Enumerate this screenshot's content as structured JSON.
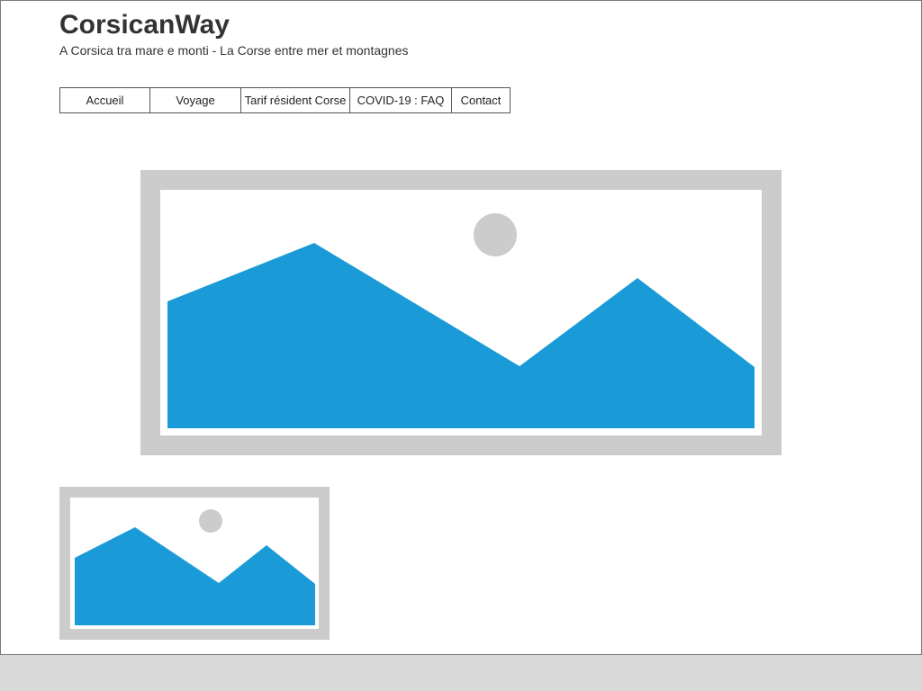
{
  "site": {
    "title": "CorsicanWay",
    "tagline": "A Corsica tra mare e monti - La Corse entre mer et montagnes"
  },
  "nav": {
    "items": [
      {
        "label": "Accueil"
      },
      {
        "label": "Voyage"
      },
      {
        "label": "Tarif résident Corse"
      },
      {
        "label": "COVID-19 : FAQ"
      },
      {
        "label": "Contact"
      }
    ]
  },
  "images": {
    "hero": {
      "icon": "image-placeholder-icon"
    },
    "thumbnail": {
      "icon": "image-placeholder-icon"
    }
  },
  "colors": {
    "placeholder_frame": "#cccccc",
    "mountain": "#1a9bd7",
    "sun": "#cccccc",
    "text": "#333333",
    "footer": "#d9d9d9"
  }
}
